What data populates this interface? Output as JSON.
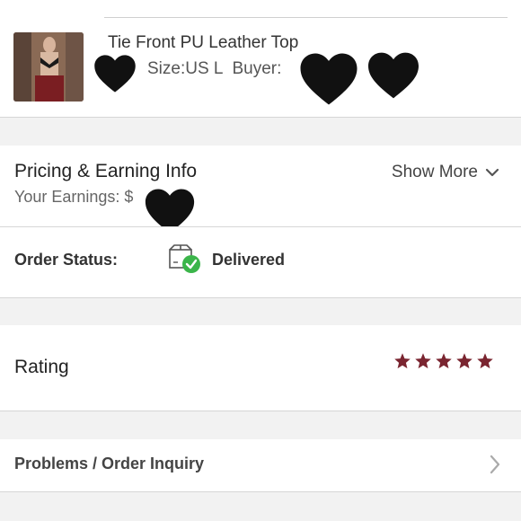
{
  "product": {
    "title": "Tie Front PU Leather Top",
    "size_text": "Size:US L",
    "buyer_text": "Buyer:",
    "thumbnail": "product-photo"
  },
  "pricing": {
    "title": "Pricing & Earning Info",
    "earnings_text": "Your Earnings: $",
    "show_more_label": "Show More"
  },
  "order_status": {
    "label": "Order Status:",
    "value": "Delivered",
    "icon": "package-delivered-icon"
  },
  "rating": {
    "label": "Rating",
    "stars": 5,
    "star_color": "#7a2530"
  },
  "problems": {
    "label": "Problems / Order Inquiry"
  },
  "colors": {
    "accent_red": "#7a2530",
    "success_green": "#3bb54a"
  }
}
